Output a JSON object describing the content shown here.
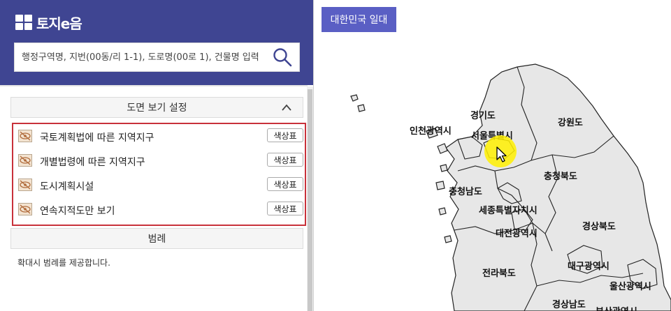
{
  "app": {
    "logo_text": "토지e음"
  },
  "search": {
    "placeholder": "행정구역명, 지번(00동/리 1-1), 도로명(00로 1), 건물명 입력"
  },
  "panel": {
    "settings_title": "도면 보기 설정",
    "layers": [
      {
        "label": "국토계획법에 따른 지역지구",
        "button": "색상표"
      },
      {
        "label": "개별법령에 따른 지역지구",
        "button": "색상표"
      },
      {
        "label": "도시계획시설",
        "button": "색상표"
      },
      {
        "label": "연속지적도만 보기",
        "button": "색상표"
      }
    ],
    "legend_title": "범례",
    "legend_note": "확대시 범례를 제공합니다."
  },
  "map": {
    "region_button": "대한민국 일대",
    "labels": {
      "incheon": "인천광역시",
      "gyeonggi": "경기도",
      "seoul": "서울특별시",
      "gangwon": "강원도",
      "chungbuk": "충청북도",
      "chungnam": "충청남도",
      "sejong": "세종특별자치시",
      "daejeon": "대전광역시",
      "gyeongbuk": "경상북도",
      "daegu": "대구광역시",
      "jeonbuk": "전라북도",
      "ulsan": "울산광역시",
      "gyeongnam": "경상남도",
      "busan": "부산광역시"
    }
  },
  "colors": {
    "header": "#3f4592",
    "accent_button": "#5a5fc4",
    "highlight_border": "#c8313a",
    "map_fill": "#e7e7e7"
  }
}
